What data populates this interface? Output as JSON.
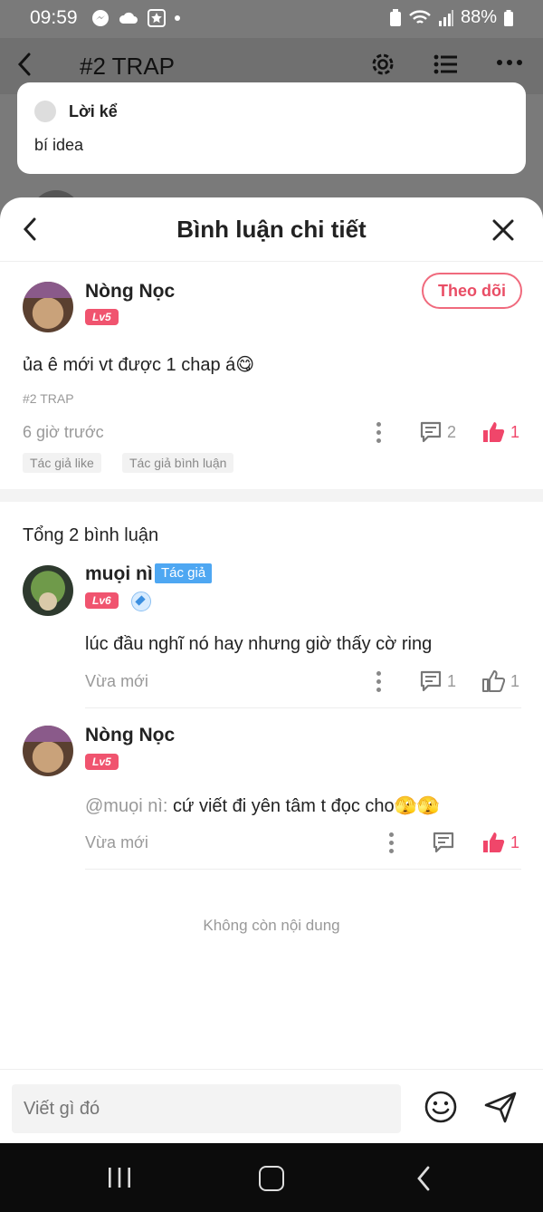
{
  "status_bar": {
    "time": "09:59",
    "battery": "88%"
  },
  "background_header": {
    "title": "#2 TRAP"
  },
  "narration": {
    "label": "Lời kể",
    "text": "bí idea"
  },
  "sheet": {
    "title": "Bình luận chi tiết"
  },
  "post": {
    "author": "Nòng Nọc",
    "level": "Lv5",
    "follow_label": "Theo dõi",
    "text": "ủa ê mới vt được 1 chap á",
    "emoji": "😋",
    "tag": "#2 TRAP",
    "time": "6 giờ trước",
    "comment_count": "2",
    "like_count": "1",
    "chips": [
      "Tác giả like",
      "Tác giả bình luận"
    ]
  },
  "comments_section": {
    "total_label": "Tổng 2 bình luận"
  },
  "comments": [
    {
      "author": "muọi nì",
      "badge": "Tác giả",
      "level": "Lv6",
      "text": "lúc đầu nghĩ nó hay nhưng giờ thấy cờ ring",
      "time": "Vừa mới",
      "comment_count": "1",
      "like_count": "1",
      "liked": false
    },
    {
      "author": "Nòng Nọc",
      "level": "Lv5",
      "mention": "@muọi nì:",
      "text": " cứ viết đi yên tâm t đọc cho",
      "emoji": "🫣🫣",
      "time": "Vừa mới",
      "like_count": "1",
      "liked": true
    }
  ],
  "end_text": "Không còn nội dung",
  "input": {
    "placeholder": "Viết gì đó"
  },
  "colors": {
    "accent": "#f0466a",
    "author_badge": "#4ea7f2",
    "level_badge": "#f0546f"
  }
}
